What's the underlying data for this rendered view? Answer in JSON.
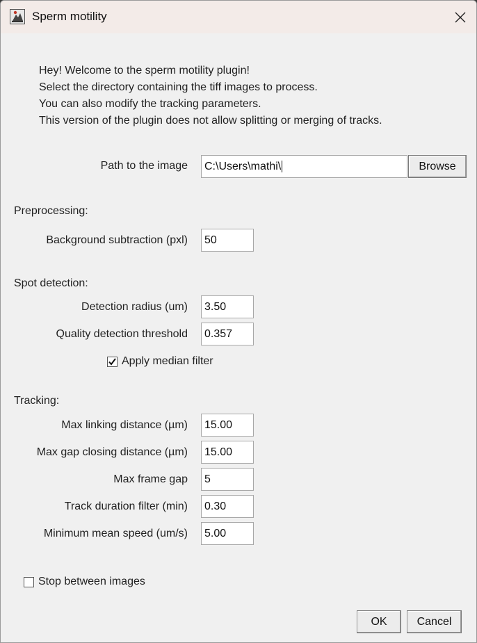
{
  "window": {
    "title": "Sperm motility"
  },
  "intro": {
    "lines": [
      "Hey! Welcome to the sperm motility plugin!",
      "Select the directory containing the tiff images to process.",
      "You can also modify the tracking parameters.",
      "This version of the plugin does not allow splitting or merging of tracks."
    ]
  },
  "path": {
    "label": "Path to the image",
    "value": "C:\\Users\\mathi\\",
    "browse_label": "Browse"
  },
  "preprocessing": {
    "heading": "Preprocessing:",
    "background_label": "Background subtraction (pxl)",
    "background_value": "50"
  },
  "spot_detection": {
    "heading": "Spot detection:",
    "radius_label": "Detection radius (um)",
    "radius_value": "3.50",
    "quality_label": "Quality detection threshold",
    "quality_value": "0.357",
    "median_label": "Apply median filter",
    "median_checked": true
  },
  "tracking": {
    "heading": "Tracking:",
    "max_linking_label": "Max linking distance (µm)",
    "max_linking_value": "15.00",
    "max_gap_closing_label": "Max gap closing distance (µm)",
    "max_gap_closing_value": "15.00",
    "max_frame_gap_label": "Max frame gap",
    "max_frame_gap_value": "5",
    "track_duration_label": "Track duration filter (min)",
    "track_duration_value": "0.30",
    "min_speed_label": "Minimum mean speed (um/s)",
    "min_speed_value": "5.00"
  },
  "stop_between": {
    "label": "Stop between images",
    "checked": false
  },
  "buttons": {
    "ok": "OK",
    "cancel": "Cancel"
  }
}
